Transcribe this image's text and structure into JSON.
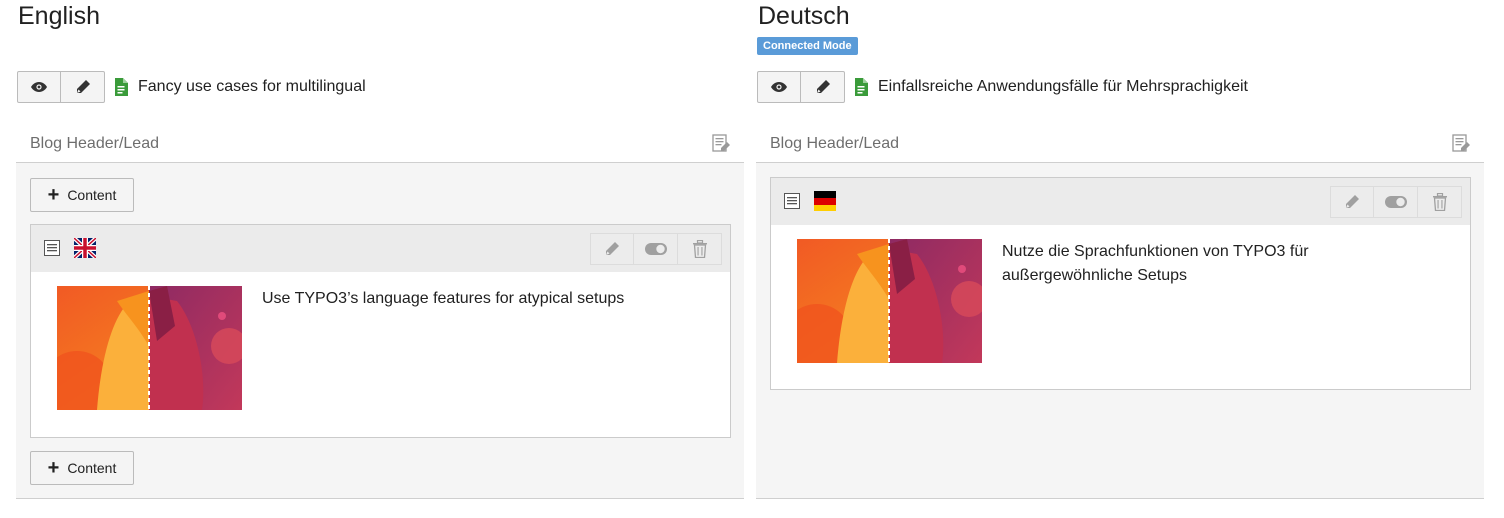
{
  "columns": [
    {
      "language_title": "English",
      "badge": "",
      "page_title": "Fancy use cases for multilingual",
      "colpos_label": "Blog Header/Lead",
      "add_content_label": "Content",
      "element": {
        "flag": "uk-flag-icon",
        "text": "Use TYPO3’s language features for atypical setups"
      }
    },
    {
      "language_title": "Deutsch",
      "badge": "Connected Mode",
      "page_title": "Einfallsreiche Anwendungsfälle für Mehrsprachigkeit",
      "colpos_label": "Blog Header/Lead",
      "element": {
        "flag": "germany-flag-icon",
        "text": "Nutze die Sprachfunktionen von TYPO3 für außergewöhnliche Setups"
      }
    }
  ],
  "colors": {
    "badge": "#5a9bd8",
    "page_icon": "#3a9b3a",
    "thumbnail_orange": "#f7931e",
    "thumbnail_magenta": "#b03a5b"
  },
  "icons": [
    "eye-icon",
    "pencil-icon",
    "page-icon",
    "edit-record-icon",
    "text-content-icon",
    "toggle-icon",
    "trash-icon",
    "plus-icon"
  ]
}
